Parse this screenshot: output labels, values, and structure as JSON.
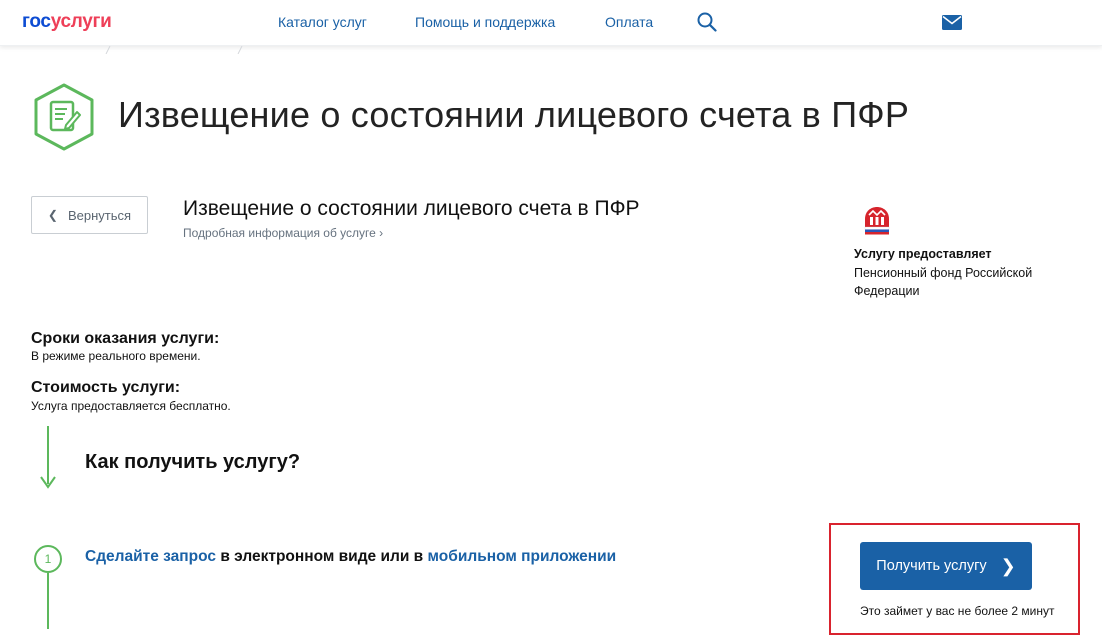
{
  "header": {
    "logo_part1": "гос",
    "logo_part2": "услуги",
    "nav": [
      "Каталог услуг",
      "Помощь и поддержка",
      "Оплата"
    ],
    "icons": [
      "search-icon",
      "mail-icon"
    ]
  },
  "page": {
    "title": "Извещение о состоянии лицевого счета в ПФР",
    "title_icon": "document-edit-icon"
  },
  "service": {
    "back_label": "Вернуться",
    "title": "Извещение о состоянии лицевого счета в ПФР",
    "info_link": "Подробная информация об услуге"
  },
  "provider": {
    "label": "Услугу предоставляет",
    "name": "Пенсионный фонд Российской Федерации",
    "logo_icon": "pfr-logo-icon"
  },
  "terms": {
    "duration_label": "Сроки оказания услуги:",
    "duration_value": "В режиме реального времени.",
    "cost_label": "Стоимость услуги:",
    "cost_value": "Услуга предоставляется бесплатно."
  },
  "how": {
    "title": "Как получить услугу?",
    "step_number": "1",
    "step_link1": "Сделайте запрос",
    "step_text1": " в электронном виде или в ",
    "step_link2": "мобильном приложении"
  },
  "cta": {
    "button_label": "Получить услугу",
    "note": "Это займет у вас не более 2 минут",
    "highlight_color": "#d9232e",
    "button_color": "#1a61a6"
  },
  "colors": {
    "accent_green": "#5cb85c",
    "link_blue": "#1a61a6"
  }
}
